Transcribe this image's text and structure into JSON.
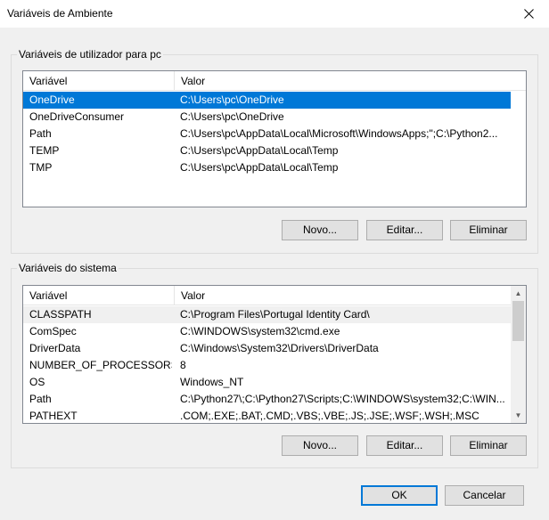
{
  "window": {
    "title": "Variáveis de Ambiente"
  },
  "user_group": {
    "label": "Variáveis de utilizador para pc",
    "columns": [
      "Variável",
      "Valor"
    ],
    "rows": [
      {
        "name": "OneDrive",
        "value": "C:\\Users\\pc\\OneDrive"
      },
      {
        "name": "OneDriveConsumer",
        "value": "C:\\Users\\pc\\OneDrive"
      },
      {
        "name": "Path",
        "value": "C:\\Users\\pc\\AppData\\Local\\Microsoft\\WindowsApps;\";C:\\Python2..."
      },
      {
        "name": "TEMP",
        "value": "C:\\Users\\pc\\AppData\\Local\\Temp"
      },
      {
        "name": "TMP",
        "value": "C:\\Users\\pc\\AppData\\Local\\Temp"
      }
    ],
    "buttons": {
      "new": "Novo...",
      "edit": "Editar...",
      "delete": "Eliminar"
    }
  },
  "system_group": {
    "label": "Variáveis do sistema",
    "columns": [
      "Variável",
      "Valor"
    ],
    "rows": [
      {
        "name": "CLASSPATH",
        "value": "C:\\Program Files\\Portugal Identity Card\\"
      },
      {
        "name": "ComSpec",
        "value": "C:\\WINDOWS\\system32\\cmd.exe"
      },
      {
        "name": "DriverData",
        "value": "C:\\Windows\\System32\\Drivers\\DriverData"
      },
      {
        "name": "NUMBER_OF_PROCESSORS",
        "value": "8"
      },
      {
        "name": "OS",
        "value": "Windows_NT"
      },
      {
        "name": "Path",
        "value": "C:\\Python27\\;C:\\Python27\\Scripts;C:\\WINDOWS\\system32;C:\\WIN..."
      },
      {
        "name": "PATHEXT",
        "value": ".COM;.EXE;.BAT;.CMD;.VBS;.VBE;.JS;.JSE;.WSF;.WSH;.MSC"
      }
    ],
    "buttons": {
      "new": "Novo...",
      "edit": "Editar...",
      "delete": "Eliminar"
    }
  },
  "footer": {
    "ok": "OK",
    "cancel": "Cancelar"
  },
  "colors": {
    "selection": "#0078d7",
    "background": "#f0f0f0"
  }
}
